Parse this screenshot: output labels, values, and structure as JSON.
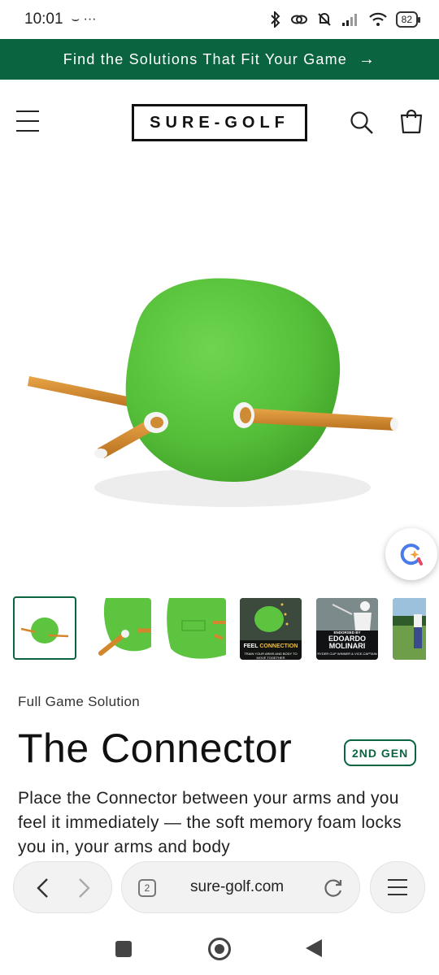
{
  "status_bar": {
    "time": "10:01",
    "notification_glyphs": "⌣ ···",
    "battery": "82"
  },
  "announcement": {
    "text": "Find the Solutions That Fit Your Game",
    "arrow": "→"
  },
  "header": {
    "logo_text": "SURE-GOLF",
    "icons": [
      "menu-icon",
      "search-icon",
      "cart-icon"
    ]
  },
  "product": {
    "collection": "Full Game Solution",
    "title": "The Connector",
    "badge": "2ND GEN",
    "description": "Place the Connector between your arms and you feel it immediately — the soft memory foam locks you in, your arms and body",
    "thumbnails": [
      {
        "caption_top": "",
        "caption_highlight": "",
        "caption_bottom": ""
      },
      {
        "caption_top": "",
        "caption_highlight": "",
        "caption_bottom": ""
      },
      {
        "caption_top": "",
        "caption_highlight": "",
        "caption_bottom": ""
      },
      {
        "caption_top": "FEEL ",
        "caption_highlight": "CONNECTION",
        "caption_bottom": "TRAIN YOUR ARMS AND BODY TO MOVE TOGETHER"
      },
      {
        "caption_top": "ENDORSED BY",
        "caption_highlight": "EDOARDO MOLINARI",
        "caption_bottom": "RYDER CUP WINNER & VICE-CAPTAIN"
      },
      {
        "caption_top": "",
        "caption_highlight": "",
        "caption_bottom": ""
      }
    ]
  },
  "browser": {
    "tab_count": "2",
    "url": "sure-golf.com"
  },
  "colors": {
    "brand_green": "#0b6440",
    "product_green": "#5cc43f",
    "rod_orange": "#d4862c"
  }
}
